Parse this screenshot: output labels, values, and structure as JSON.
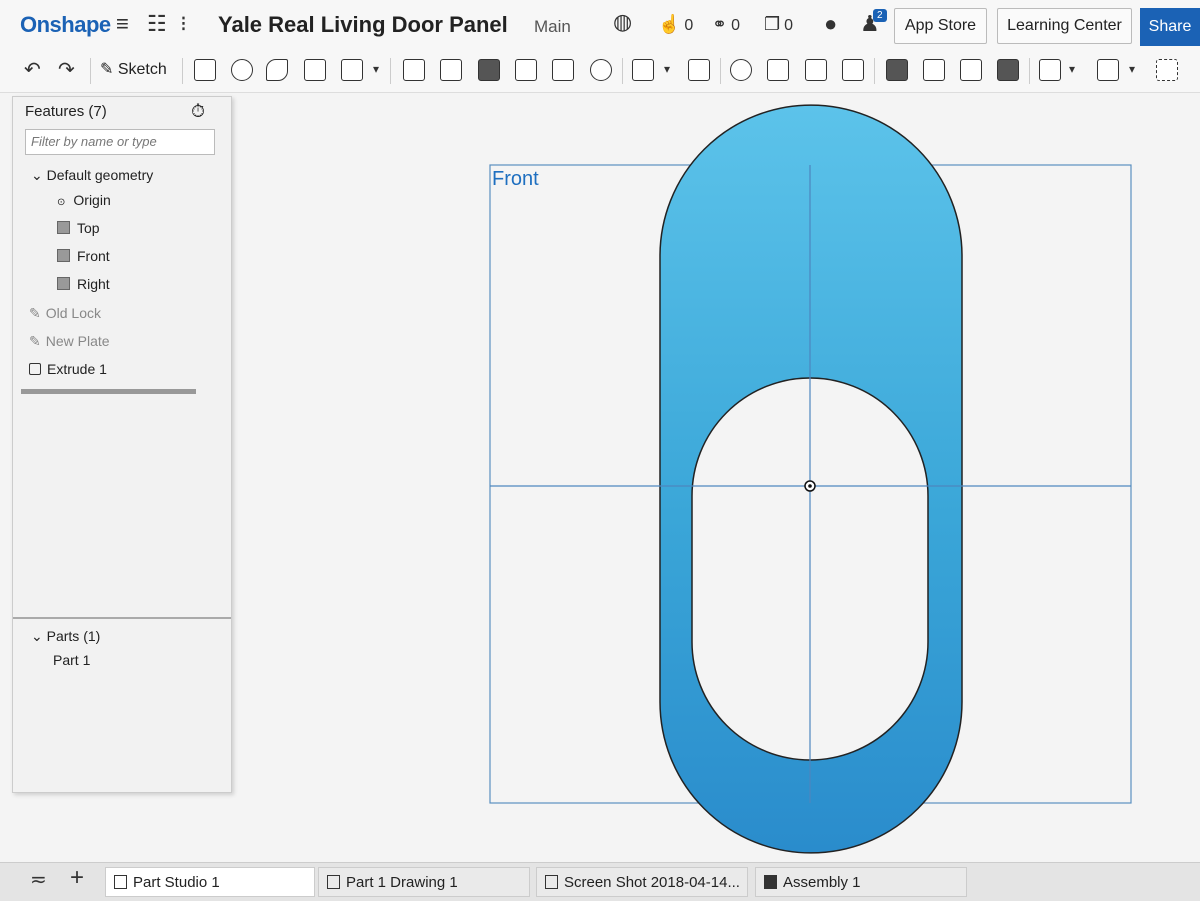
{
  "app": {
    "name": "Onshape"
  },
  "document": {
    "title": "Yale Real Living Door Panel",
    "workspace": "Main"
  },
  "stats": {
    "likes": "0",
    "links": "0",
    "copies": "0"
  },
  "notifications": {
    "count": "2"
  },
  "header_buttons": {
    "app_store": "App Store",
    "learning_center": "Learning Center",
    "share": "Share"
  },
  "toolbar": {
    "sketch_label": "Sketch"
  },
  "feature_panel": {
    "title": "Features (7)",
    "filter_placeholder": "Filter by name or type",
    "default_geometry": "Default geometry",
    "origin": "Origin",
    "planes": [
      "Top",
      "Front",
      "Right"
    ],
    "features": [
      "Old Lock",
      "New Plate",
      "Extrude 1"
    ],
    "parts_title": "Parts (1)",
    "parts": [
      "Part 1"
    ]
  },
  "viewport": {
    "view_label": "Front",
    "part_color": "#2f9fd6"
  },
  "tabs": [
    "Part Studio 1",
    "Part 1 Drawing 1",
    "Screen Shot 2018-04-14...",
    "Assembly 1"
  ]
}
